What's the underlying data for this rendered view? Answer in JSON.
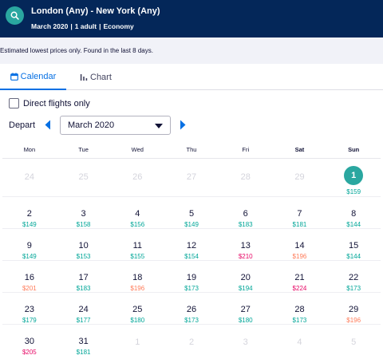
{
  "header": {
    "route": "London (Any) - New York (Any)",
    "month": "March 2020",
    "passengers": "1 adult",
    "cabin": "Economy",
    "colors": {
      "background": "#042759",
      "accent": "#2aa7a0"
    },
    "search_icon": "search-icon"
  },
  "notice": "Estimated lowest prices only. Found in the last 8 days.",
  "tabs": [
    {
      "label": "Calendar",
      "icon": "calendar-icon",
      "active": true
    },
    {
      "label": "Chart",
      "icon": "bar-chart-icon",
      "active": false
    }
  ],
  "filters": {
    "direct_label": "Direct flights only",
    "direct_checked": false
  },
  "depart": {
    "label": "Depart",
    "month_value": "March 2020"
  },
  "weekdays": [
    "Mon",
    "Tue",
    "Wed",
    "Thu",
    "Fri",
    "Sat",
    "Sun"
  ],
  "price_colors": {
    "low": "#00a698",
    "mid": "#ff7b59",
    "high": "#e70866",
    "muted": "#d4d4dc"
  },
  "calendar": {
    "weeks": [
      [
        {
          "day": "24",
          "muted": true
        },
        {
          "day": "25",
          "muted": true
        },
        {
          "day": "26",
          "muted": true
        },
        {
          "day": "27",
          "muted": true
        },
        {
          "day": "28",
          "muted": true
        },
        {
          "day": "29",
          "muted": true
        },
        {
          "day": "1",
          "price": "$159",
          "level": "low",
          "selected": true
        }
      ],
      [
        {
          "day": "2",
          "price": "$149",
          "level": "low"
        },
        {
          "day": "3",
          "price": "$158",
          "level": "low"
        },
        {
          "day": "4",
          "price": "$156",
          "level": "low"
        },
        {
          "day": "5",
          "price": "$149",
          "level": "low"
        },
        {
          "day": "6",
          "price": "$183",
          "level": "low"
        },
        {
          "day": "7",
          "price": "$181",
          "level": "low"
        },
        {
          "day": "8",
          "price": "$144",
          "level": "low"
        }
      ],
      [
        {
          "day": "9",
          "price": "$149",
          "level": "low"
        },
        {
          "day": "10",
          "price": "$153",
          "level": "low"
        },
        {
          "day": "11",
          "price": "$155",
          "level": "low"
        },
        {
          "day": "12",
          "price": "$154",
          "level": "low"
        },
        {
          "day": "13",
          "price": "$210",
          "level": "high"
        },
        {
          "day": "14",
          "price": "$196",
          "level": "mid"
        },
        {
          "day": "15",
          "price": "$144",
          "level": "low"
        }
      ],
      [
        {
          "day": "16",
          "price": "$201",
          "level": "mid"
        },
        {
          "day": "17",
          "price": "$183",
          "level": "low"
        },
        {
          "day": "18",
          "price": "$196",
          "level": "mid"
        },
        {
          "day": "19",
          "price": "$173",
          "level": "low"
        },
        {
          "day": "20",
          "price": "$194",
          "level": "low"
        },
        {
          "day": "21",
          "price": "$224",
          "level": "high"
        },
        {
          "day": "22",
          "price": "$173",
          "level": "low"
        }
      ],
      [
        {
          "day": "23",
          "price": "$179",
          "level": "low"
        },
        {
          "day": "24",
          "price": "$177",
          "level": "low"
        },
        {
          "day": "25",
          "price": "$180",
          "level": "low"
        },
        {
          "day": "26",
          "price": "$173",
          "level": "low"
        },
        {
          "day": "27",
          "price": "$180",
          "level": "low"
        },
        {
          "day": "28",
          "price": "$173",
          "level": "low"
        },
        {
          "day": "29",
          "price": "$196",
          "level": "mid"
        }
      ],
      [
        {
          "day": "30",
          "price": "$205",
          "level": "high"
        },
        {
          "day": "31",
          "price": "$181",
          "level": "low"
        },
        {
          "day": "1",
          "muted": true
        },
        {
          "day": "2",
          "muted": true
        },
        {
          "day": "3",
          "muted": true
        },
        {
          "day": "4",
          "muted": true
        },
        {
          "day": "5",
          "muted": true
        }
      ]
    ]
  }
}
